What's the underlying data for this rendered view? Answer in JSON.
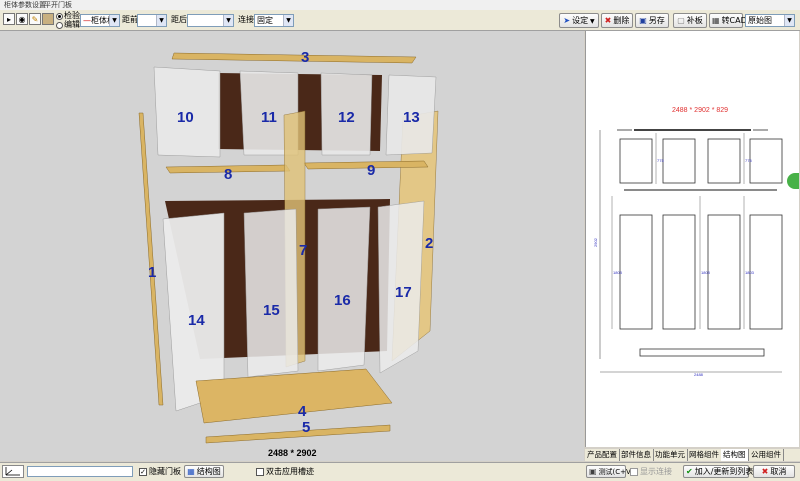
{
  "titlebar": {
    "tabs": [
      "柜体参数设置",
      "平开门板"
    ]
  },
  "toolbar": {
    "icons": [
      "select-icon",
      "eye-icon",
      "pencil-icon",
      "box-icon"
    ],
    "radio1_label": "检验",
    "radio2_label": "编辑",
    "cabinet_type": "柜体板",
    "left_dist_label": "距前",
    "left_dist_value": "",
    "rear_dist_label": "距后",
    "rear_dist_value": "",
    "connect_label": "连接",
    "connect_value": "固定",
    "settings_label": "设定",
    "delete_label": "删除",
    "save_label": "另存",
    "patch_label": "补板",
    "cad_label": "转CAD",
    "view_value": "原始图"
  },
  "viewport": {
    "panel_labels": [
      "1",
      "2",
      "3",
      "4",
      "5",
      "7",
      "8",
      "9",
      "10",
      "11",
      "12",
      "13",
      "14",
      "15",
      "16",
      "17"
    ],
    "dimension_text": "2488 * 2902"
  },
  "right_pane": {
    "dimension_title": "2488 * 2902 * 829",
    "height_label": "2902",
    "width_label": "2488",
    "upper_dims": [
      "775",
      "775"
    ],
    "lower_dims": [
      "1803",
      "1803",
      "1803"
    ]
  },
  "tabs": [
    "产品配置",
    "部件信息",
    "功能单元",
    "网格组件",
    "结构图",
    "公用组件"
  ],
  "bottombar": {
    "hide_door_label": "隐藏门板",
    "hide_door_checked": true,
    "structure_label": "结构图",
    "double_click_label": "双击应用槽迹",
    "test_label": "测试(C+V)",
    "show_conn_label": "显示连接",
    "add_update_label": "加入/更新到列表",
    "cancel_label": "取消"
  },
  "colors": {
    "panel_wood": "#d9b463",
    "panel_back": "#4a2818",
    "panel_glass": "#e8e8e8",
    "label_blue": "#1a2aa8",
    "dim_red": "#e03030"
  }
}
